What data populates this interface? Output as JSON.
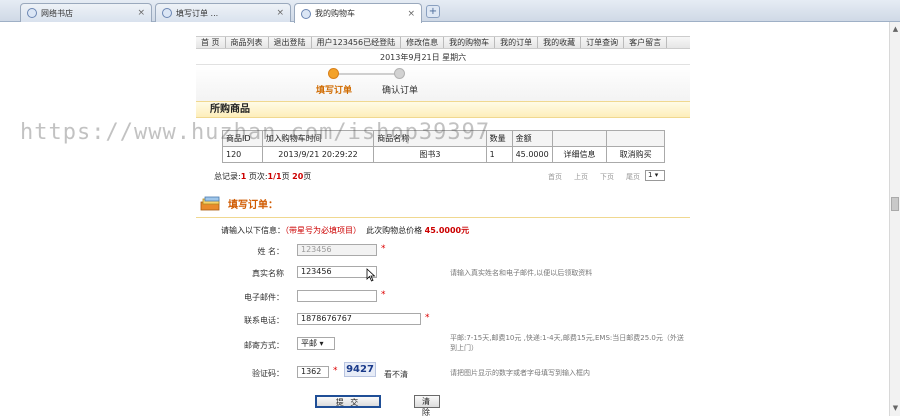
{
  "browser": {
    "tabs": [
      {
        "label": "网络书店",
        "active": false
      },
      {
        "label": "填写订单 ...",
        "active": false
      },
      {
        "label": "我的购物车",
        "active": true
      }
    ],
    "close_glyph": "×",
    "new_tab_glyph": "+"
  },
  "nav": [
    "首 页",
    "商品列表",
    "退出登陆",
    "用户123456已经登陆",
    "修改信息",
    "我的购物车",
    "我的订单",
    "我的收藏",
    "订单查询",
    "客户留言"
  ],
  "date": "2013年9月21日 星期六",
  "steps": [
    "填写订单",
    "确认订单"
  ],
  "section_title": "所购商品",
  "cart": {
    "headers": [
      "商品ID",
      "加入购物车时间",
      "商品名称",
      "数量",
      "金额",
      "",
      ""
    ],
    "rows": [
      {
        "id": "120",
        "time": "2013/9/21 20:29:22",
        "name": "图书3",
        "qty": "1",
        "amount": "45.0000",
        "detail": "详细信息",
        "cancel": "取消购买"
      }
    ]
  },
  "paging": {
    "total_label": "总记录:",
    "total": "1",
    "page_label": "页次:",
    "page": "1/1",
    "page_suffix": "页",
    "size": "20",
    "size_suffix": "页",
    "links": [
      "首页",
      "上页",
      "下页",
      "尾页"
    ],
    "select_value": "1"
  },
  "order": {
    "title": "填写订单：",
    "prompt": "请输入以下信息：",
    "hint": "（带星号为必填项目）",
    "total_label": "此次购物总价格",
    "total_price": "45.0000元"
  },
  "form": {
    "name_label": "姓 名：",
    "name_value": "123456",
    "realname_label": "真实名称",
    "realname_value": "123456",
    "realname_tip": "请输入真实姓名和电子邮件,以便以后领取资料",
    "email_label": "电子邮件：",
    "email_value": "",
    "phone_label": "联系电话：",
    "phone_value": "1878676767",
    "shipping_label": "邮寄方式：",
    "shipping_value": "平邮",
    "shipping_tip": "平邮:7-15天,邮费10元 ,快递:1-4天,邮费15元,EMS:当日邮费25.0元（外送到上门）",
    "captcha_label": "验证码：",
    "captcha_value": "1362",
    "captcha_image": "9427",
    "captcha_refresh": "看不清",
    "captcha_tip": "请把图片显示的数字或者字母填写到输入框内",
    "required_mark": "*"
  },
  "buttons": {
    "submit": "提 交",
    "clear": "清 除"
  },
  "watermark": "https://www.huzhan.com/ishop39397",
  "colors": {
    "accent": "#d05a00",
    "price": "#cc0000",
    "step_active": "#f3a22a",
    "section_bg": "#fdeebb"
  }
}
